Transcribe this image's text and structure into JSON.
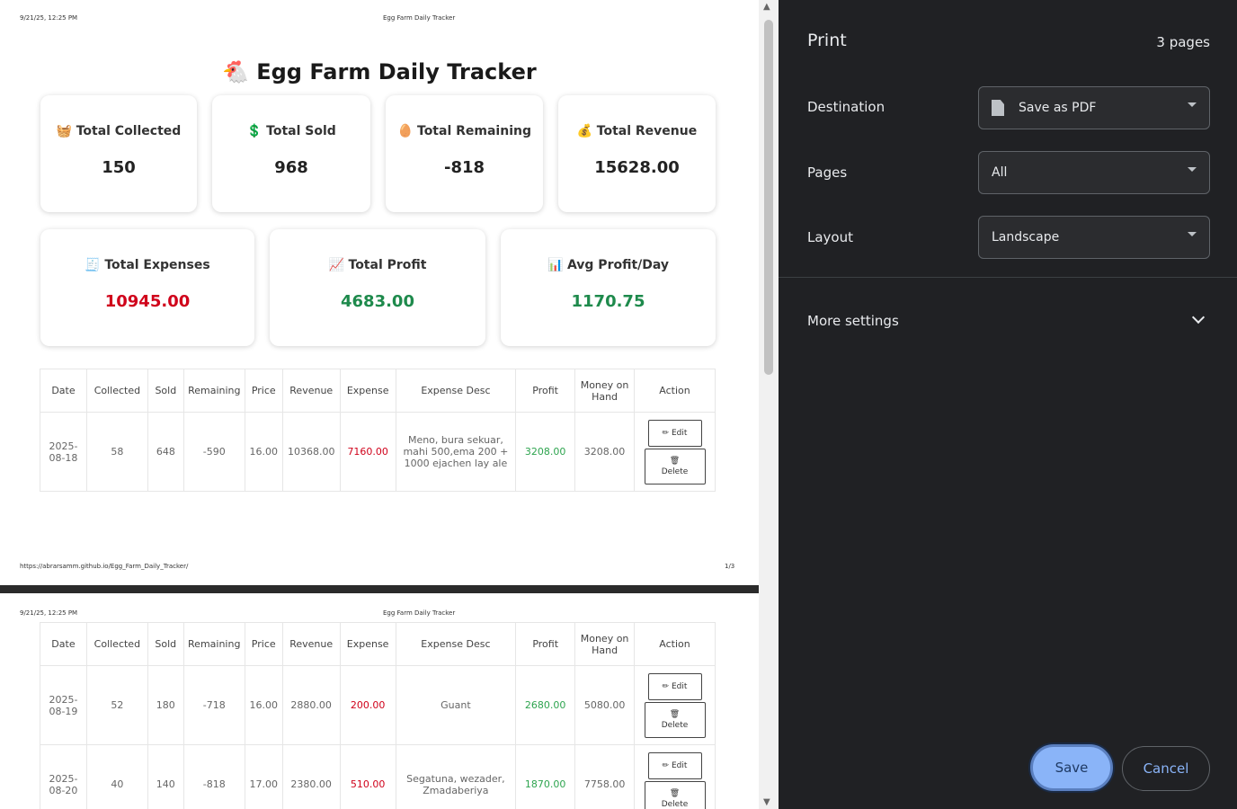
{
  "preview": {
    "page1": {
      "header_left": "9/21/25, 12:25 PM",
      "header_center": "Egg Farm Daily Tracker",
      "footer_left": "https://abrarsamm.github.io/Egg_Farm_Daily_Tracker/",
      "footer_right": "1/3",
      "title": "Egg Farm Daily Tracker",
      "title_emoji": "🐔",
      "cards_row1": [
        {
          "icon": "🧺",
          "label": "Total Collected",
          "value": "150"
        },
        {
          "icon": "💲",
          "label": "Total Sold",
          "value": "968"
        },
        {
          "icon": "🥚",
          "label": "Total Remaining",
          "value": "-818"
        },
        {
          "icon": "💰",
          "label": "Total Revenue",
          "value": "15628.00"
        }
      ],
      "cards_row2": [
        {
          "icon": "🧾",
          "label": "Total Expenses",
          "value": "10945.00"
        },
        {
          "icon": "📈",
          "label": "Total Profit",
          "value": "4683.00"
        },
        {
          "icon": "📊",
          "label": "Avg Profit/Day",
          "value": "1170.75"
        }
      ]
    },
    "page2": {
      "header_left": "9/21/25, 12:25 PM",
      "header_center": "Egg Farm Daily Tracker"
    },
    "table": {
      "headers": [
        "Date",
        "Collected",
        "Sold",
        "Remaining",
        "Price",
        "Revenue",
        "Expense",
        "Expense Desc",
        "Profit",
        "Money on Hand",
        "Action"
      ],
      "edit_label": "Edit",
      "delete_label": "Delete",
      "rows": [
        {
          "date": "2025-08-18",
          "collected": "58",
          "sold": "648",
          "remaining": "-590",
          "price": "16.00",
          "revenue": "10368.00",
          "expense": "7160.00",
          "desc": "Meno, bura sekuar, mahi 500,ema 200 + 1000 ejachen lay ale",
          "profit": "3208.00",
          "money": "3208.00"
        },
        {
          "date": "2025-08-19",
          "collected": "52",
          "sold": "180",
          "remaining": "-718",
          "price": "16.00",
          "revenue": "2880.00",
          "expense": "200.00",
          "desc": "Guant",
          "profit": "2680.00",
          "money": "5080.00"
        },
        {
          "date": "2025-08-20",
          "collected": "40",
          "sold": "140",
          "remaining": "-818",
          "price": "17.00",
          "revenue": "2380.00",
          "expense": "510.00",
          "desc": "Segatuna, wezader, Zmadaberiya",
          "profit": "1870.00",
          "money": "7758.00"
        }
      ]
    }
  },
  "panel": {
    "title": "Print",
    "page_count": "3 pages",
    "destination_label": "Destination",
    "destination_value": "Save as PDF",
    "pages_label": "Pages",
    "pages_value": "All",
    "layout_label": "Layout",
    "layout_value": "Landscape",
    "more_settings": "More settings",
    "save": "Save",
    "cancel": "Cancel"
  }
}
